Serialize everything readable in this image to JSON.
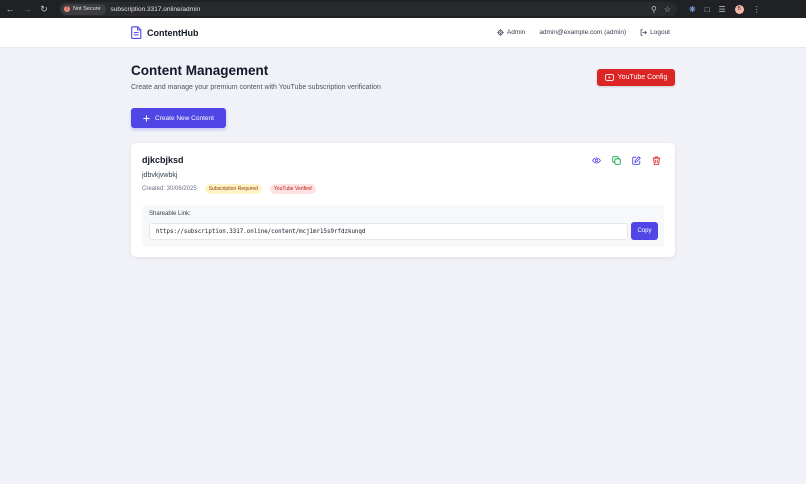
{
  "browser": {
    "security_label": "Not Secure",
    "url": "subscription.3317.online/admin",
    "profile_initial": "B"
  },
  "header": {
    "brand": "ContentHub",
    "admin_label": "Admin",
    "user_email": "admin@example.com (admin)",
    "logout_label": "Logout"
  },
  "page": {
    "title": "Content Management",
    "subtitle": "Create and manage your premium content with YouTube subscription verification",
    "youtube_config_label": "YouTube Config",
    "create_label": "Create New Content"
  },
  "content_item": {
    "title": "djkcbjksd",
    "description": "jdbvkjvwbkj",
    "created": "Created: 30/06/2025",
    "badges": [
      "Subscription Required",
      "YouTube Verified"
    ],
    "share_label": "Shareable Link:",
    "share_url": "https://subscription.3317.online/content/mcj1mr15s9rfdzkunqd",
    "copy_label": "Copy"
  },
  "colors": {
    "primary": "#4f46e5",
    "danger": "#dc2626",
    "background": "#f1f2f8"
  }
}
